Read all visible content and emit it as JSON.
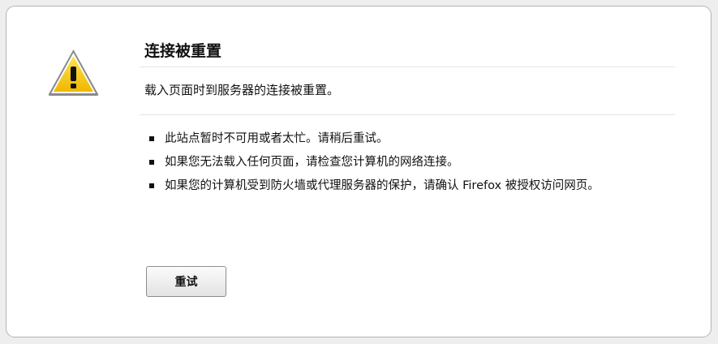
{
  "error": {
    "icon": "warning-icon",
    "title": "连接被重置",
    "description": "载入页面时到服务器的连接被重置。",
    "reasons": [
      "此站点暂时不可用或者太忙。请稍后重试。",
      "如果您无法载入任何页面，请检查您计算机的网络连接。",
      "如果您的计算机受到防火墙或代理服务器的保护，请确认 Firefox 被授权访问网页。"
    ],
    "retry_label": "重试"
  },
  "colors": {
    "icon_fill": "#f3c400",
    "icon_border": "#7a7a7a",
    "panel_border": "#b9b9b9"
  }
}
